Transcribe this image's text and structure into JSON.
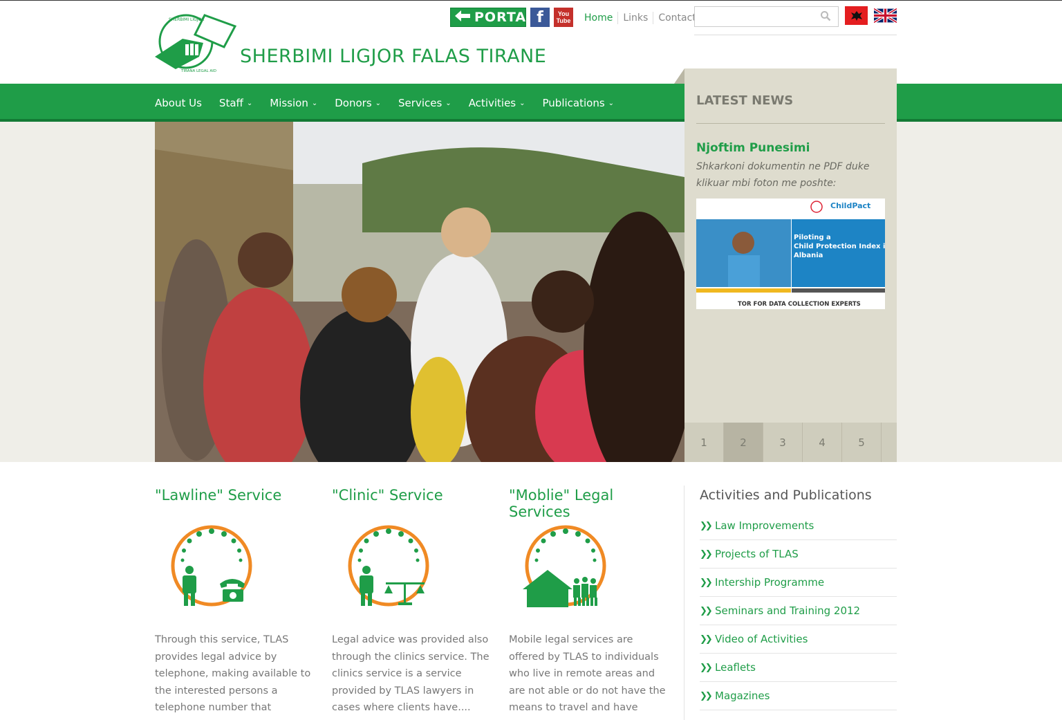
{
  "site": {
    "title": "SHERBIMI LIGJOR FALAS TIRANE",
    "logo_text_top": "SHERBIMI LIGJOR FALAS TIRANE",
    "logo_text_bottom": "TIRANA LEGAL AID SOCIETY"
  },
  "header": {
    "portal_label": "PORTAL",
    "facebook_label": "f",
    "youtube_label": "You Tube",
    "links": [
      "Home",
      "Links",
      "Contact"
    ],
    "search_placeholder": ""
  },
  "nav": [
    {
      "label": "About Us",
      "dropdown": false
    },
    {
      "label": "Staff",
      "dropdown": true
    },
    {
      "label": "Mission",
      "dropdown": true
    },
    {
      "label": "Donors",
      "dropdown": true
    },
    {
      "label": "Services",
      "dropdown": true
    },
    {
      "label": "Activities",
      "dropdown": true
    },
    {
      "label": "Publications",
      "dropdown": true
    }
  ],
  "news": {
    "heading": "LATEST NEWS",
    "item_title": "Njoftim Punesimi",
    "item_text": "Shkarkoni dokumentin ne PDF duke klikuar mbi foton me poshte:",
    "thumb_text": "Piloting a Child Protection Index in Albania",
    "thumb_footer": "TOR FOR DATA COLLECTION EXPERTS",
    "thumb_logo": "ChildPact",
    "pages": [
      "1",
      "2",
      "3",
      "4",
      "5"
    ],
    "active_page": "2"
  },
  "services": [
    {
      "title": "\"Lawline\" Service",
      "text": "Through this service, TLAS provides legal advice by telephone, making available to the interested persons a telephone number that everyone",
      "icon": "telephone-icon"
    },
    {
      "title": "\"Clinic\" Service",
      "text": "Legal advice was provided also through the clinics service. The clinics service is a service provided by TLAS lawyers in cases where clients have....",
      "icon": "scales-icon"
    },
    {
      "title": "\"Moblie\" Legal Services",
      "text": "Mobile legal services are offered by TLAS to individuals who live in remote areas and are not able or do not have the means to travel and have access....",
      "icon": "house-icon"
    }
  ],
  "activities": {
    "heading": "Activities and Publications",
    "items": [
      "Law Improvements",
      "Projects of TLAS",
      "Intership Programme",
      "Seminars and Training 2012",
      "Video of Activities",
      "Leaflets",
      "Magazines"
    ]
  },
  "colors": {
    "brand_green": "#1f9d48",
    "accent_orange": "#f08a24",
    "panel_beige": "#dedcce"
  }
}
